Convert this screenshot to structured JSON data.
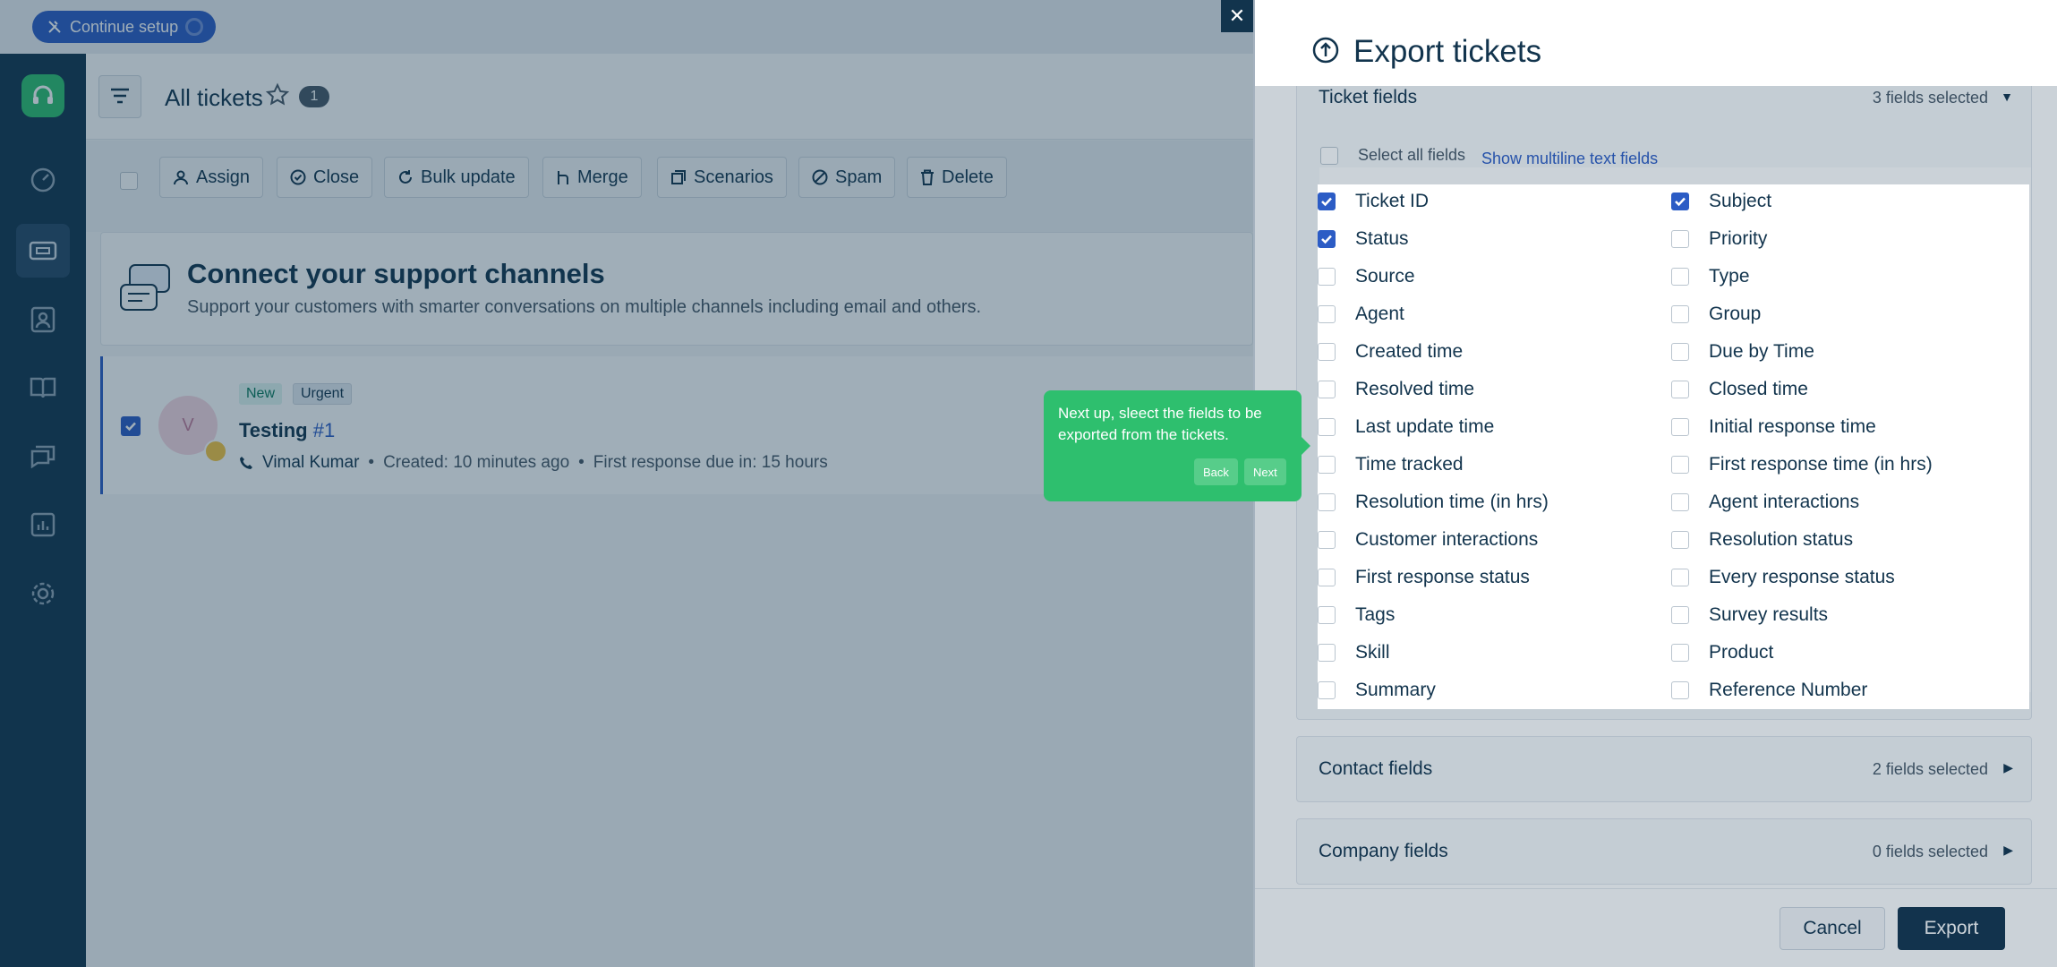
{
  "topbar": {
    "setup_label": "Continue setup"
  },
  "header": {
    "title": "All tickets",
    "count": "1"
  },
  "toolbar": {
    "assign": "Assign",
    "close": "Close",
    "bulk_update": "Bulk update",
    "merge": "Merge",
    "scenarios": "Scenarios",
    "spam": "Spam",
    "delete": "Delete"
  },
  "connect": {
    "title": "Connect your support channels",
    "subtitle": "Support your customers with smarter conversations on multiple channels including email and others."
  },
  "ticket": {
    "tag_new": "New",
    "tag_urgent": "Urgent",
    "subject": "Testing",
    "number": "#1",
    "avatar_letter": "V",
    "agent": "Vimal Kumar",
    "created": "Created: 10 minutes ago",
    "first_response": "First response due in: 15 hours",
    "dot": "•"
  },
  "panel": {
    "title": "Export tickets",
    "close": "✕",
    "ticket_fields": {
      "title": "Ticket fields",
      "count": "3 fields selected",
      "select_all": "Select all fields",
      "show_multiline": "Show multiline text fields",
      "fields": [
        {
          "label": "Ticket ID",
          "checked": true
        },
        {
          "label": "Subject",
          "checked": true
        },
        {
          "label": "Status",
          "checked": true
        },
        {
          "label": "Priority",
          "checked": false
        },
        {
          "label": "Source",
          "checked": false
        },
        {
          "label": "Type",
          "checked": false
        },
        {
          "label": "Agent",
          "checked": false
        },
        {
          "label": "Group",
          "checked": false
        },
        {
          "label": "Created time",
          "checked": false
        },
        {
          "label": "Due by Time",
          "checked": false
        },
        {
          "label": "Resolved time",
          "checked": false
        },
        {
          "label": "Closed time",
          "checked": false
        },
        {
          "label": "Last update time",
          "checked": false
        },
        {
          "label": "Initial response time",
          "checked": false
        },
        {
          "label": "Time tracked",
          "checked": false
        },
        {
          "label": "First response time (in hrs)",
          "checked": false
        },
        {
          "label": "Resolution time (in hrs)",
          "checked": false
        },
        {
          "label": "Agent interactions",
          "checked": false
        },
        {
          "label": "Customer interactions",
          "checked": false
        },
        {
          "label": "Resolution status",
          "checked": false
        },
        {
          "label": "First response status",
          "checked": false
        },
        {
          "label": "Every response status",
          "checked": false
        },
        {
          "label": "Tags",
          "checked": false
        },
        {
          "label": "Survey results",
          "checked": false
        },
        {
          "label": "Skill",
          "checked": false
        },
        {
          "label": "Product",
          "checked": false
        },
        {
          "label": "Summary",
          "checked": false
        },
        {
          "label": "Reference Number",
          "checked": false
        }
      ]
    },
    "contact_fields": {
      "title": "Contact fields",
      "count": "2 fields selected"
    },
    "company_fields": {
      "title": "Company fields",
      "count": "0 fields selected"
    },
    "cancel": "Cancel",
    "export": "Export"
  },
  "tooltip": {
    "text": "Next up, sleect the fields to be exported from the tickets.",
    "back": "Back",
    "next": "Next"
  },
  "colors": {
    "brand_green": "#2ebf6e",
    "primary_blue": "#2c5cc5",
    "navy": "#12344d"
  }
}
